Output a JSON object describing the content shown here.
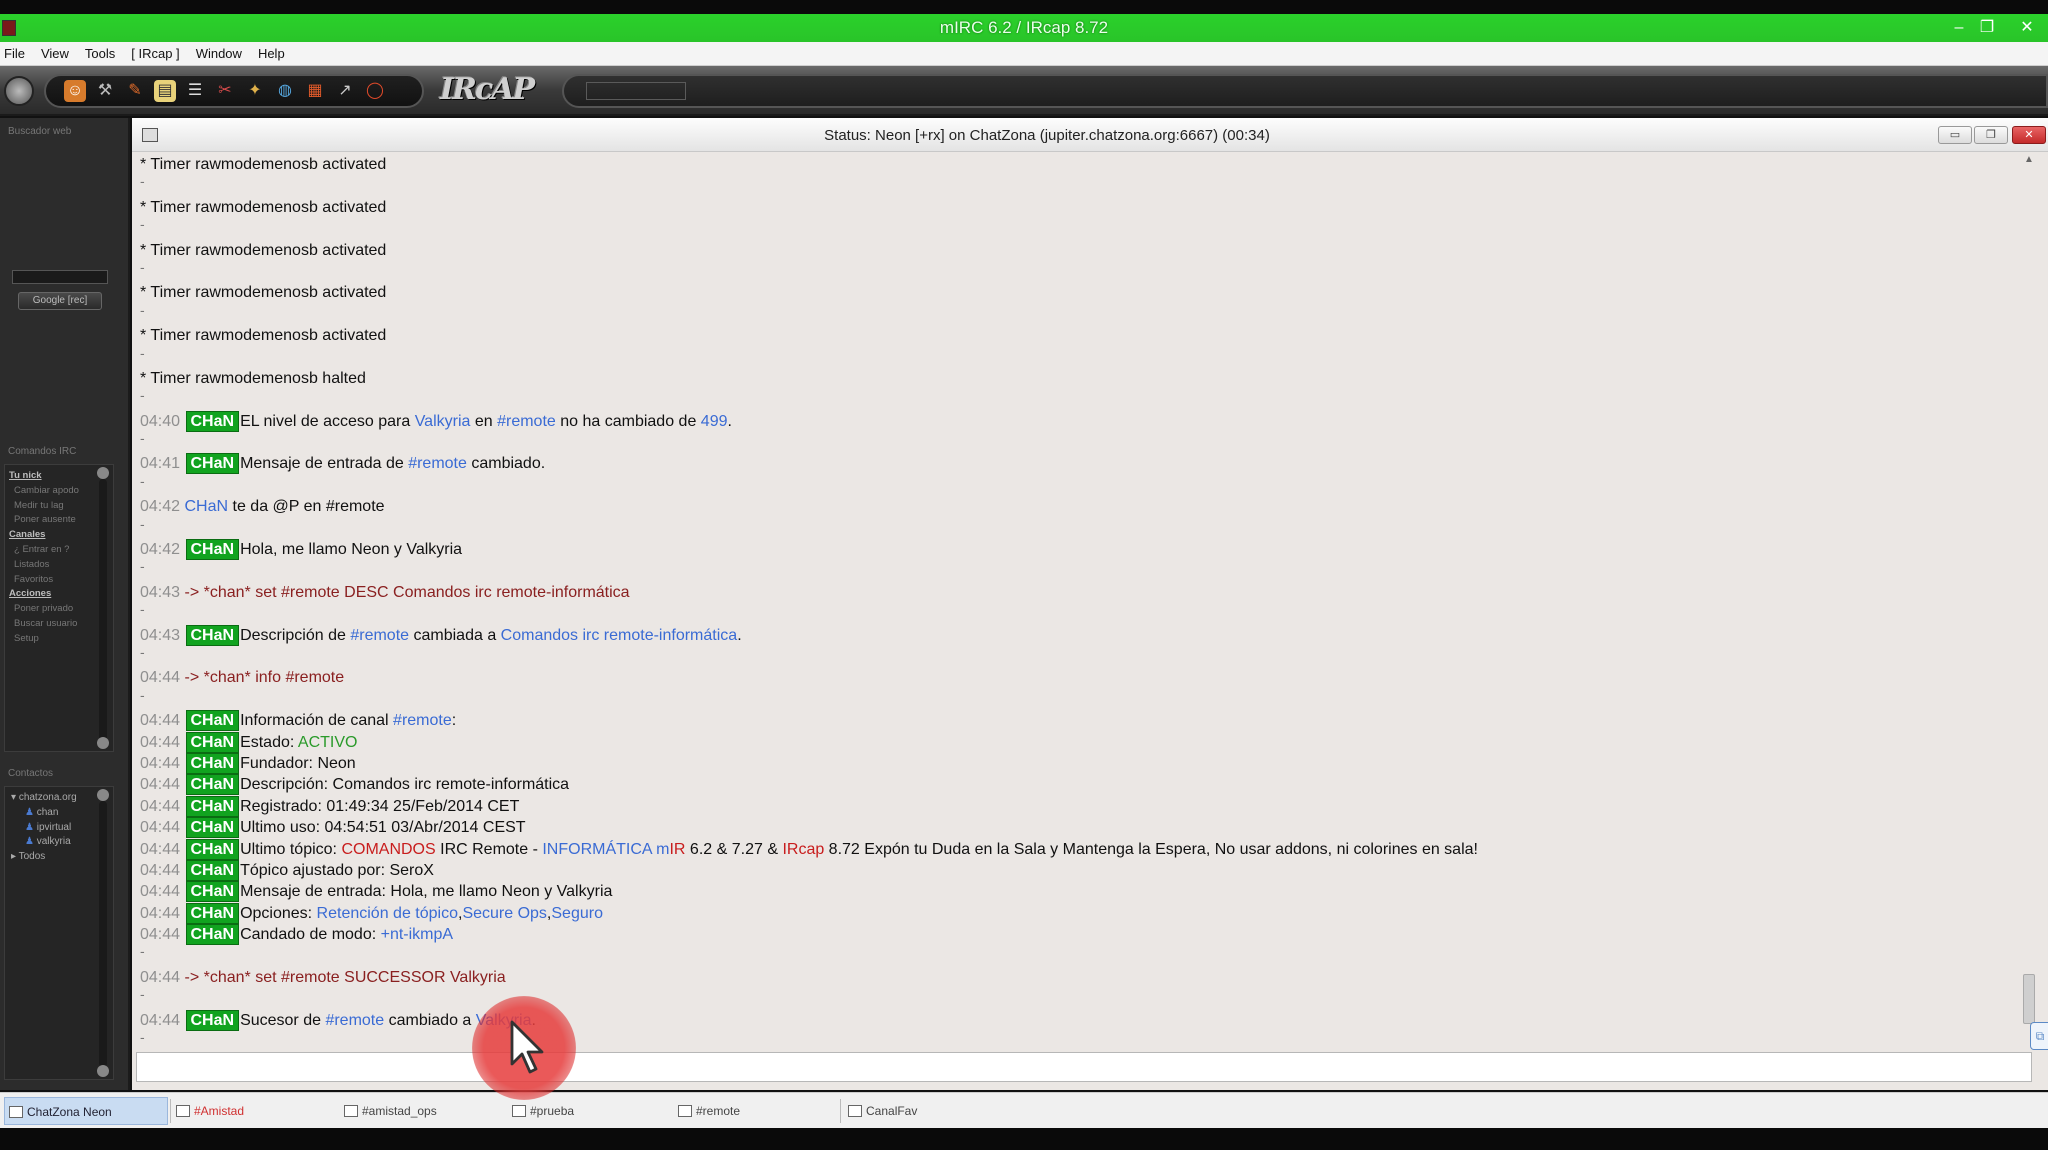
{
  "window": {
    "title": "mIRC 6.2 / IRcap 8.72"
  },
  "menu": [
    "File",
    "View",
    "Tools",
    "[ IRcap ]",
    "Window",
    "Help"
  ],
  "sidebar": {
    "search_title": "Buscador web",
    "google_label": "Google [rec]",
    "commands_title": "Comandos IRC",
    "commands": [
      {
        "label": "Tu nick",
        "head": true
      },
      {
        "label": "Cambiar apodo",
        "head": false
      },
      {
        "label": "Medir tu lag",
        "head": false
      },
      {
        "label": "Poner ausente",
        "head": false
      },
      {
        "label": "Canales",
        "head": true
      },
      {
        "label": "¿ Entrar en ?",
        "head": false
      },
      {
        "label": "Listados",
        "head": false
      },
      {
        "label": "Favoritos",
        "head": false
      },
      {
        "label": "Acciones",
        "head": true
      },
      {
        "label": "Poner privado",
        "head": false
      },
      {
        "label": "Buscar usuario",
        "head": false
      },
      {
        "label": "Setup",
        "head": false
      }
    ],
    "contacts_title": "Contactos",
    "contacts": {
      "server": "chatzona.org",
      "people": [
        "chan",
        "ipvirtual",
        "valkyria"
      ],
      "all": "Todos"
    }
  },
  "status_window": {
    "title": "Status: Neon [+rx] on ChatZona (jupiter.chatzona.org:6667) (00:34)"
  },
  "chat": [
    {
      "k": "line",
      "segs": [
        [
          "",
          "* Timer rawmodemenosb activated"
        ]
      ]
    },
    {
      "k": "sep"
    },
    {
      "k": "line",
      "segs": [
        [
          "",
          "* Timer rawmodemenosb activated"
        ]
      ]
    },
    {
      "k": "sep"
    },
    {
      "k": "line",
      "segs": [
        [
          "",
          "* Timer rawmodemenosb activated"
        ]
      ]
    },
    {
      "k": "sep"
    },
    {
      "k": "line",
      "segs": [
        [
          "",
          "* Timer rawmodemenosb activated"
        ]
      ]
    },
    {
      "k": "sep"
    },
    {
      "k": "line",
      "segs": [
        [
          "",
          "* Timer rawmodemenosb activated"
        ]
      ]
    },
    {
      "k": "sep"
    },
    {
      "k": "line",
      "segs": [
        [
          "",
          "* Timer rawmodemenosb halted"
        ]
      ]
    },
    {
      "k": "sep"
    },
    {
      "k": "line",
      "segs": [
        [
          "ts",
          "04:40"
        ],
        [
          "badge",
          "CHaN"
        ],
        [
          "",
          "EL nivel de acceso para "
        ],
        [
          "link",
          "Valkyria"
        ],
        [
          "",
          " en "
        ],
        [
          "link",
          "#remote"
        ],
        [
          "",
          " no ha cambiado de "
        ],
        [
          "link",
          "499"
        ],
        [
          "",
          "."
        ]
      ]
    },
    {
      "k": "sep"
    },
    {
      "k": "line",
      "segs": [
        [
          "ts",
          "04:41"
        ],
        [
          "badge",
          "CHaN"
        ],
        [
          "",
          "Mensaje de entrada de "
        ],
        [
          "link",
          "#remote"
        ],
        [
          "",
          " cambiado."
        ]
      ]
    },
    {
      "k": "sep"
    },
    {
      "k": "line",
      "segs": [
        [
          "ts",
          "04:42"
        ],
        [
          "link",
          "CHaN"
        ],
        [
          "",
          " te da @P en #remote"
        ]
      ]
    },
    {
      "k": "sep"
    },
    {
      "k": "line",
      "segs": [
        [
          "ts",
          "04:42"
        ],
        [
          "badge",
          "CHaN"
        ],
        [
          "",
          "Hola, me llamo Neon y Valkyria"
        ]
      ]
    },
    {
      "k": "sep"
    },
    {
      "k": "line",
      "segs": [
        [
          "ts",
          "04:43"
        ],
        [
          "cmd",
          "-> *chan* set #remote DESC Comandos irc remote-informática"
        ]
      ]
    },
    {
      "k": "sep"
    },
    {
      "k": "line",
      "segs": [
        [
          "ts",
          "04:43"
        ],
        [
          "badge",
          "CHaN"
        ],
        [
          "",
          "Descripción de "
        ],
        [
          "link",
          "#remote"
        ],
        [
          "",
          " cambiada a "
        ],
        [
          "link",
          "Comandos irc remote-informática"
        ],
        [
          "",
          "."
        ]
      ]
    },
    {
      "k": "sep"
    },
    {
      "k": "line",
      "segs": [
        [
          "ts",
          "04:44"
        ],
        [
          "cmd",
          "-> *chan* info #remote"
        ]
      ]
    },
    {
      "k": "sep"
    },
    {
      "k": "line",
      "segs": [
        [
          "ts",
          "04:44"
        ],
        [
          "badge",
          "CHaN"
        ],
        [
          "",
          "Información de canal "
        ],
        [
          "link",
          "#remote"
        ],
        [
          "",
          ":"
        ]
      ]
    },
    {
      "k": "line",
      "segs": [
        [
          "ts",
          "04:44"
        ],
        [
          "badge",
          "CHaN"
        ],
        [
          "",
          "Estado: "
        ],
        [
          "green",
          "ACTIVO"
        ]
      ]
    },
    {
      "k": "line",
      "segs": [
        [
          "ts",
          "04:44"
        ],
        [
          "badge",
          "CHaN"
        ],
        [
          "",
          "Fundador: Neon"
        ]
      ]
    },
    {
      "k": "line",
      "segs": [
        [
          "ts",
          "04:44"
        ],
        [
          "badge",
          "CHaN"
        ],
        [
          "",
          "Descripción: Comandos irc remote-informática"
        ]
      ]
    },
    {
      "k": "line",
      "segs": [
        [
          "ts",
          "04:44"
        ],
        [
          "badge",
          "CHaN"
        ],
        [
          "",
          "Registrado: 01:49:34 25/Feb/2014 CET"
        ]
      ]
    },
    {
      "k": "line",
      "segs": [
        [
          "ts",
          "04:44"
        ],
        [
          "badge",
          "CHaN"
        ],
        [
          "",
          "Ultimo uso: 04:54:51 03/Abr/2014 CEST"
        ]
      ]
    },
    {
      "k": "line",
      "segs": [
        [
          "ts",
          "04:44"
        ],
        [
          "badge",
          "CHaN"
        ],
        [
          "",
          "Ultimo tópico: "
        ],
        [
          "red",
          "COMANDOS"
        ],
        [
          "",
          " IRC Remote - "
        ],
        [
          "link",
          "INFORMÁTICA"
        ],
        [
          "",
          " "
        ],
        [
          "link",
          "m"
        ],
        [
          "red",
          "IR"
        ],
        [
          "",
          "   6.2 & 7.27 & "
        ],
        [
          "red",
          "IRcap"
        ],
        [
          "",
          " 8.72  Expón tu Duda en la Sala y Mantenga la Espera, No usar addons, ni colorines en sala!"
        ]
      ]
    },
    {
      "k": "line",
      "segs": [
        [
          "ts",
          "04:44"
        ],
        [
          "badge",
          "CHaN"
        ],
        [
          "",
          "Tópico ajustado por: SeroX"
        ]
      ]
    },
    {
      "k": "line",
      "segs": [
        [
          "ts",
          "04:44"
        ],
        [
          "badge",
          "CHaN"
        ],
        [
          "",
          "Mensaje de entrada: Hola, me llamo Neon y Valkyria"
        ]
      ]
    },
    {
      "k": "line",
      "segs": [
        [
          "ts",
          "04:44"
        ],
        [
          "badge",
          "CHaN"
        ],
        [
          "",
          "Opciones: "
        ],
        [
          "link",
          "Retención de tópico"
        ],
        [
          "",
          ","
        ],
        [
          "link",
          "Secure Ops"
        ],
        [
          "",
          ","
        ],
        [
          "link",
          "Seguro"
        ]
      ]
    },
    {
      "k": "line",
      "segs": [
        [
          "ts",
          "04:44"
        ],
        [
          "badge",
          "CHaN"
        ],
        [
          "",
          "Candado de modo: "
        ],
        [
          "link",
          "+nt-ikmpA"
        ]
      ]
    },
    {
      "k": "sep"
    },
    {
      "k": "line",
      "segs": [
        [
          "ts",
          "04:44"
        ],
        [
          "cmd",
          "-> *chan* set #remote SUCCESSOR Valkyria"
        ]
      ]
    },
    {
      "k": "sep"
    },
    {
      "k": "line",
      "segs": [
        [
          "ts",
          "04:44"
        ],
        [
          "badge",
          "CHaN"
        ],
        [
          "",
          "Sucesor de "
        ],
        [
          "link",
          "#remote"
        ],
        [
          "",
          " cambiado a "
        ],
        [
          "link",
          "Valkyria"
        ],
        [
          "",
          "."
        ]
      ]
    },
    {
      "k": "sep"
    }
  ],
  "switchbar": [
    {
      "label": "ChatZona Neon",
      "state": "active"
    },
    {
      "label": "#Amistad",
      "state": "alert"
    },
    {
      "label": "#amistad_ops",
      "state": "normal"
    },
    {
      "label": "#prueba",
      "state": "normal"
    },
    {
      "label": "#remote",
      "state": "normal"
    },
    {
      "label": "CanalFav",
      "state": "normal"
    }
  ],
  "colors": {
    "title_green": "#29c429",
    "badge_green": "#11a31f",
    "link_blue": "#3a6bd4",
    "alert_red": "#c81d1d"
  }
}
